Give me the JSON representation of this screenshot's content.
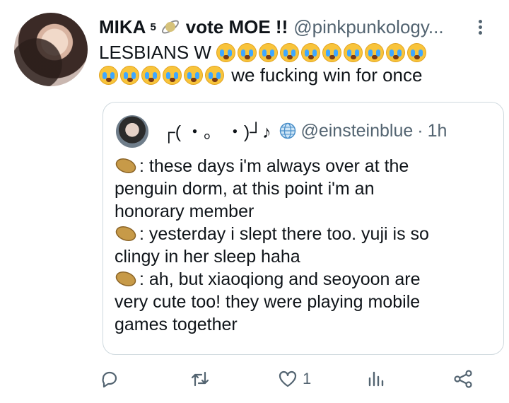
{
  "tweet": {
    "display_name": "MIKA",
    "superscript": "5",
    "after_name": "vote MOE !!",
    "handle": "@pinkpunkology...",
    "text_line1": "LESBIANS W",
    "text_line2_suffix": "we fucking win for once",
    "emoji_line1_count": 10,
    "emoji_line2_count": 6
  },
  "quote": {
    "display_name": "┌( ・。 ・)┘♪",
    "handle": "@einsteinblue",
    "separator": "·",
    "time": "1h",
    "lines": [
      ": these days i'm always over at the",
      "penguin dorm, at this point i'm an",
      "honorary member",
      ": yesterday i slept there too. yuji is so",
      "clingy in her sleep haha",
      ": ah, but xiaoqiong and seoyoon are",
      "very cute too! they were playing mobile",
      "games together"
    ]
  },
  "actions": {
    "reply_icon": "reply-icon",
    "retweet_icon": "retweet-icon",
    "like_icon": "heart-icon",
    "like_count": "1",
    "analytics_icon": "analytics-icon",
    "share_icon": "share-icon"
  },
  "colors": {
    "muted": "#536471",
    "border": "#cfd9de",
    "text": "#0f1419"
  }
}
